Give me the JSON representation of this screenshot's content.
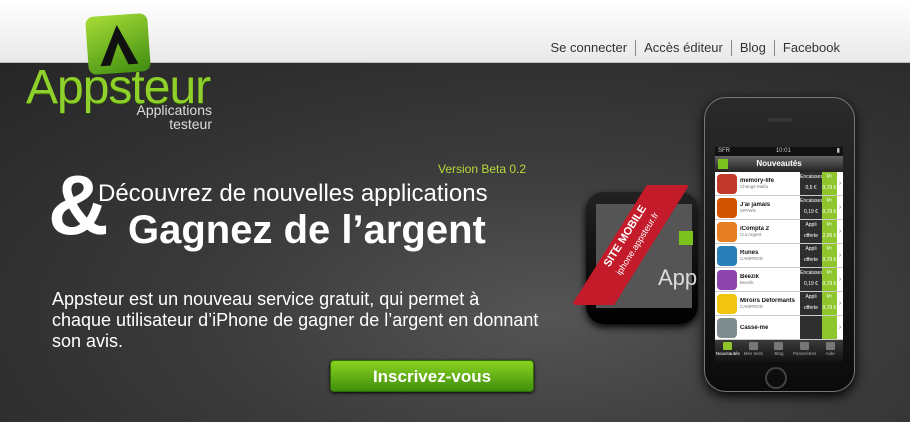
{
  "brand": {
    "name": "Appsteur",
    "tagline_1": "Applications",
    "tagline_2": "testeur",
    "accent": "#8fd12a"
  },
  "nav": [
    "Se connecter",
    "Accès éditeur",
    "Blog",
    "Facebook"
  ],
  "hero": {
    "version": "Version Beta 0.2",
    "amp": "&",
    "headline_1": "Découvrez de nouvelles applications",
    "headline_2": "Gagnez de l’argent",
    "description": "Appsteur est un nouveau service gratuit, qui permet à chaque utilisateur d’iPhone de gagner de l’argent en donnant son avis.",
    "cta": "Inscrivez-vous"
  },
  "ribbon": {
    "line1": "SITE MOBILE",
    "line2": "iphone.appsteur.fr"
  },
  "landscape_phone": {
    "word": "App"
  },
  "phone": {
    "carrier": "SFR",
    "time": "10:01",
    "title": "Nouveautés",
    "apps": [
      {
        "name": "memory-life",
        "sub": "Change Mafia",
        "mid_1": "Encaissez",
        "mid_2": "0,5 €",
        "p1": "Pr",
        "p2": "0,79 €",
        "icon_color": "#c0392b"
      },
      {
        "name": "J'ai jamais",
        "sub": "SIPIWS",
        "mid_1": "Encaissez",
        "mid_2": "0,19 €",
        "p1": "Pr",
        "p2": "0,79 €",
        "icon_color": "#d35400"
      },
      {
        "name": "iCompta 2",
        "sub": "Cut Argent",
        "mid_1": "Appli",
        "mid_2": "offerte",
        "p1": "Pr",
        "p2": "2,99 €",
        "icon_color": "#e67e22"
      },
      {
        "name": "Runes",
        "sub": "CAMPROD",
        "mid_1": "Appli",
        "mid_2": "offerte",
        "p1": "Pr",
        "p2": "0,79 €",
        "icon_color": "#2980b9"
      },
      {
        "name": "Beezik",
        "sub": "Beezik",
        "mid_1": "Encaissez",
        "mid_2": "0,19 €",
        "p1": "Pr",
        "p2": "0,79 €",
        "icon_color": "#8e44ad"
      },
      {
        "name": "Miroirs Déformants",
        "sub": "CAMPROD",
        "mid_1": "Appli",
        "mid_2": "offerte",
        "p1": "Pr",
        "p2": "0,79 €",
        "icon_color": "#f1c40f"
      },
      {
        "name": "Casse-me",
        "sub": "",
        "mid_1": "",
        "mid_2": "",
        "p1": "",
        "p2": "",
        "icon_color": "#7f8c8d"
      }
    ],
    "tabs": [
      "Nouveautés",
      "Mes tests",
      "Blog",
      "Paramètres",
      "Aide"
    ]
  }
}
